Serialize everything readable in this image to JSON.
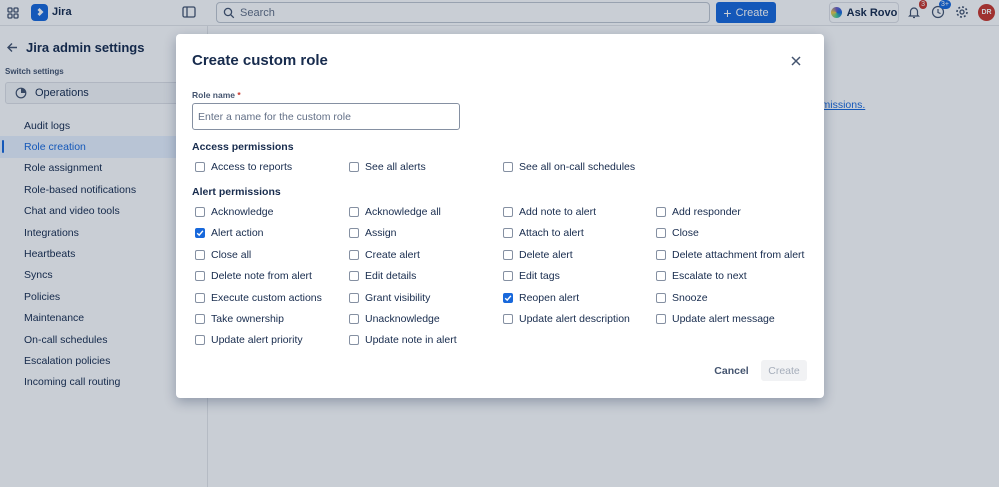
{
  "app": {
    "name": "Jira"
  },
  "search": {
    "placeholder": "Search"
  },
  "topbar": {
    "create_label": "Create",
    "ask_rovo_label": "Ask Rovo",
    "notifications_count": "3",
    "help_count": "3+",
    "avatar_initials": "DR"
  },
  "sidebar": {
    "title": "Jira admin settings",
    "switch_label": "Switch settings",
    "switch_value": "Operations",
    "items": [
      {
        "label": "Audit logs"
      },
      {
        "label": "Role creation"
      },
      {
        "label": "Role assignment"
      },
      {
        "label": "Role-based notifications"
      },
      {
        "label": "Chat and video tools"
      },
      {
        "label": "Integrations"
      },
      {
        "label": "Heartbeats"
      },
      {
        "label": "Syncs"
      },
      {
        "label": "Policies"
      },
      {
        "label": "Maintenance"
      },
      {
        "label": "On-call schedules"
      },
      {
        "label": "Escalation policies"
      },
      {
        "label": "Incoming call routing"
      }
    ]
  },
  "background": {
    "link_text": "rmissions."
  },
  "modal": {
    "title": "Create custom role",
    "role_name_label": "Role name",
    "role_name_required": "*",
    "role_name_placeholder": "Enter a name for the custom role",
    "access_section": "Access permissions",
    "access_permissions": [
      {
        "label": "Access to reports",
        "checked": false
      },
      {
        "label": "See all alerts",
        "checked": false
      },
      {
        "label": "See all on-call schedules",
        "checked": false
      }
    ],
    "alert_section": "Alert permissions",
    "alert_permissions": [
      {
        "label": "Acknowledge",
        "checked": false
      },
      {
        "label": "Acknowledge all",
        "checked": false
      },
      {
        "label": "Add note to alert",
        "checked": false
      },
      {
        "label": "Add responder",
        "checked": false
      },
      {
        "label": "Alert action",
        "checked": true
      },
      {
        "label": "Assign",
        "checked": false
      },
      {
        "label": "Attach to alert",
        "checked": false
      },
      {
        "label": "Close",
        "checked": false
      },
      {
        "label": "Close all",
        "checked": false
      },
      {
        "label": "Create alert",
        "checked": false
      },
      {
        "label": "Delete alert",
        "checked": false
      },
      {
        "label": "Delete attachment from alert",
        "checked": false
      },
      {
        "label": "Delete note from alert",
        "checked": false
      },
      {
        "label": "Edit details",
        "checked": false
      },
      {
        "label": "Edit tags",
        "checked": false
      },
      {
        "label": "Escalate to next",
        "checked": false
      },
      {
        "label": "Execute custom actions",
        "checked": false
      },
      {
        "label": "Grant visibility",
        "checked": false
      },
      {
        "label": "Reopen alert",
        "checked": true
      },
      {
        "label": "Snooze",
        "checked": false
      },
      {
        "label": "Take ownership",
        "checked": false
      },
      {
        "label": "Unacknowledge",
        "checked": false
      },
      {
        "label": "Update alert description",
        "checked": false
      },
      {
        "label": "Update alert message",
        "checked": false
      },
      {
        "label": "Update alert priority",
        "checked": false
      },
      {
        "label": "Update note in alert",
        "checked": false
      }
    ],
    "cancel_label": "Cancel",
    "create_label": "Create"
  },
  "colors": {
    "brand": "#1868db",
    "danger": "#c9372c",
    "text": "#172b4d"
  }
}
